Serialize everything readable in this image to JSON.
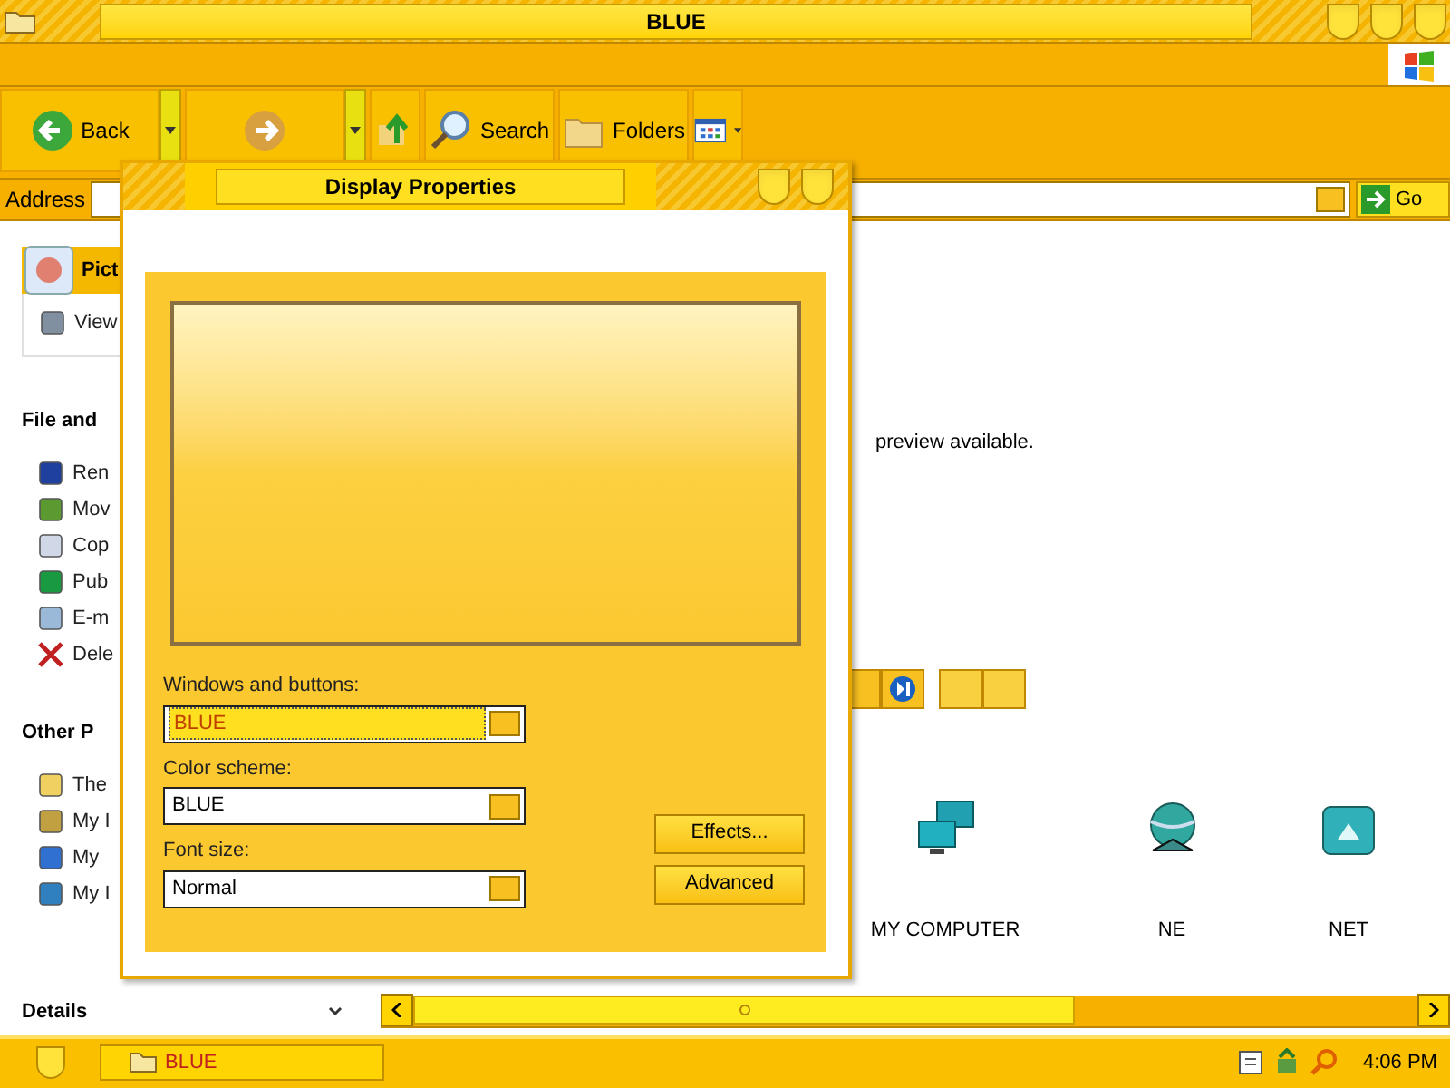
{
  "window": {
    "title": "BLUE"
  },
  "toolbar": {
    "buttons": [
      {
        "kind": "back",
        "label": "Back"
      },
      {
        "kind": "forward"
      },
      {
        "kind": "up"
      },
      {
        "kind": "search",
        "label": "Search"
      },
      {
        "kind": "folders",
        "label": "Folders"
      },
      {
        "kind": "views"
      }
    ]
  },
  "address_bar": {
    "label": "Address",
    "go": "Go"
  },
  "sidebar": {
    "sections": [
      {
        "title": "Pict",
        "highlighted": true,
        "items": [
          "View"
        ]
      },
      {
        "title": "File and",
        "highlighted": false,
        "items": [
          "Ren",
          "Mov",
          "Cop",
          "Pub",
          "E-m",
          "Dele"
        ]
      },
      {
        "title": "Other P",
        "highlighted": false,
        "items": [
          "The",
          "My I",
          "My",
          "My I"
        ]
      },
      {
        "title": "Details",
        "highlighted": false,
        "collapsible": true
      }
    ]
  },
  "content": {
    "preview_text": "preview available.",
    "icons": [
      {
        "label": "MY COMPUTER"
      },
      {
        "label": "NE"
      },
      {
        "label": "NET"
      }
    ]
  },
  "dialog": {
    "title": "Display Properties",
    "fields": [
      {
        "label": "Windows and buttons:",
        "value": "BLUE",
        "focused": true
      },
      {
        "label": "Color scheme:",
        "value": "BLUE",
        "focused": false
      },
      {
        "label": "Font size:",
        "value": "Normal",
        "focused": false
      }
    ],
    "buttons": [
      "Effects...",
      "Advanced"
    ]
  },
  "taskbar": {
    "tasks": [
      {
        "label": "BLUE"
      }
    ],
    "clock": "4:06 PM"
  }
}
